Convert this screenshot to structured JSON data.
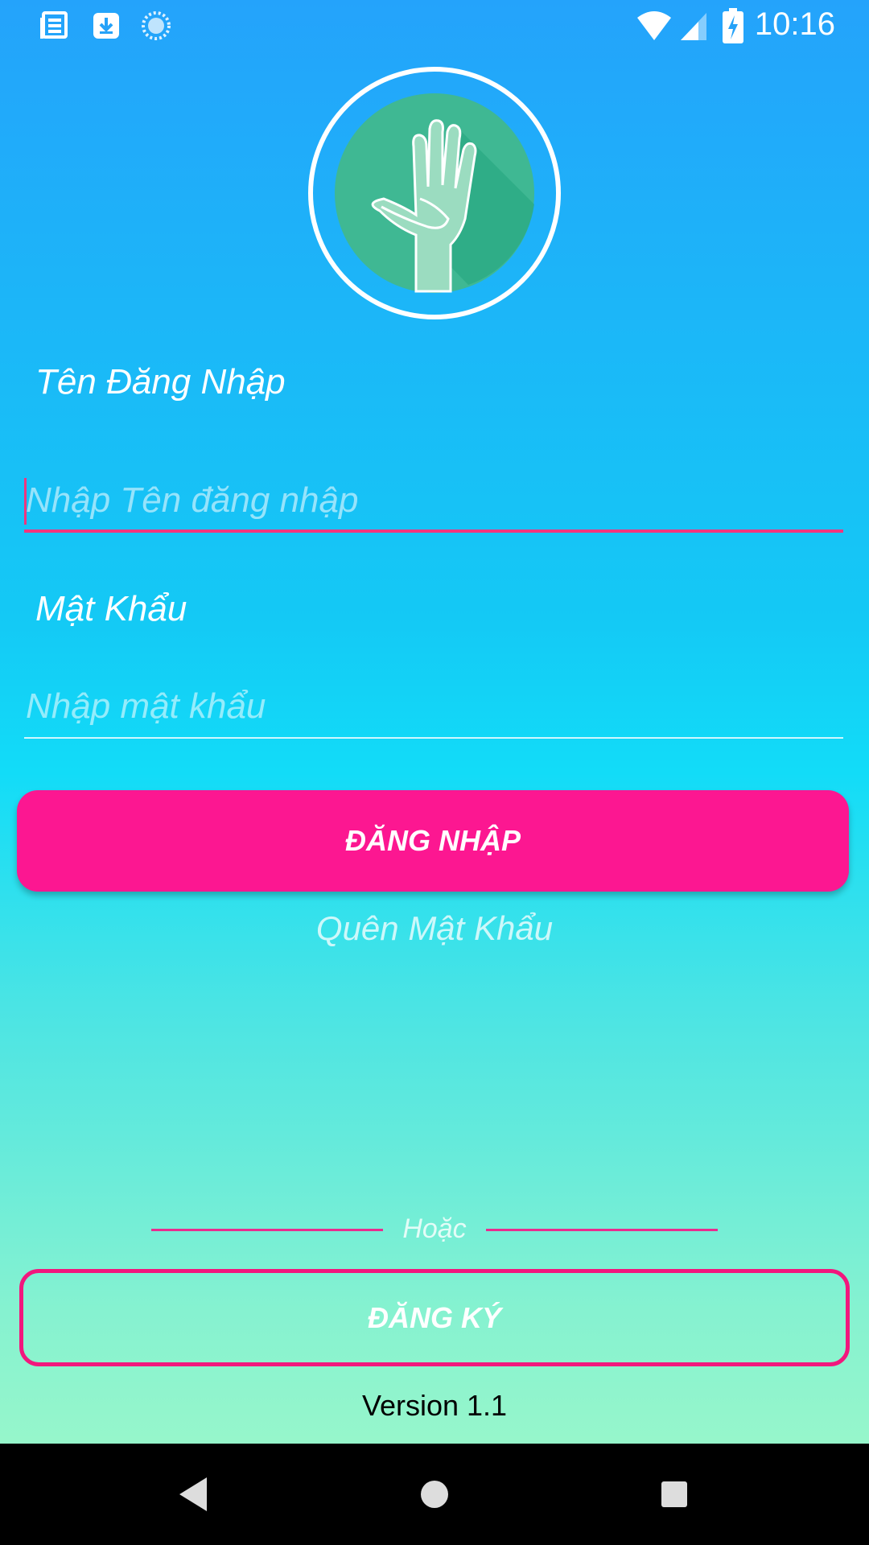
{
  "status_bar": {
    "time": "10:16",
    "left_icons": [
      "news-icon",
      "download-icon",
      "sync-icon"
    ],
    "right_icons": [
      "wifi-icon",
      "signal-icon",
      "battery-charging-icon"
    ]
  },
  "logo": {
    "icon": "helping-hand-icon",
    "ring_color": "#ffffff",
    "circle_color": "#3fb893"
  },
  "form": {
    "username_label": "Tên Đăng Nhập",
    "username_placeholder": "Nhập Tên đăng nhập",
    "username_value": "",
    "password_label": "Mật Khẩu",
    "password_placeholder": "Nhập mật khẩu",
    "password_value": ""
  },
  "actions": {
    "login_label": "ĐĂNG NHẬP",
    "forgot_label": "Quên Mật Khẩu",
    "divider_label": "Hoặc",
    "register_label": "ĐĂNG KÝ"
  },
  "footer": {
    "version": "Version 1.1"
  },
  "nav_bar": {
    "icons": [
      "back-icon",
      "home-icon",
      "recents-icon"
    ]
  },
  "colors": {
    "accent": "#fc1791",
    "gradient_top": "#24a3fb",
    "gradient_bottom": "#a3f9c7"
  }
}
